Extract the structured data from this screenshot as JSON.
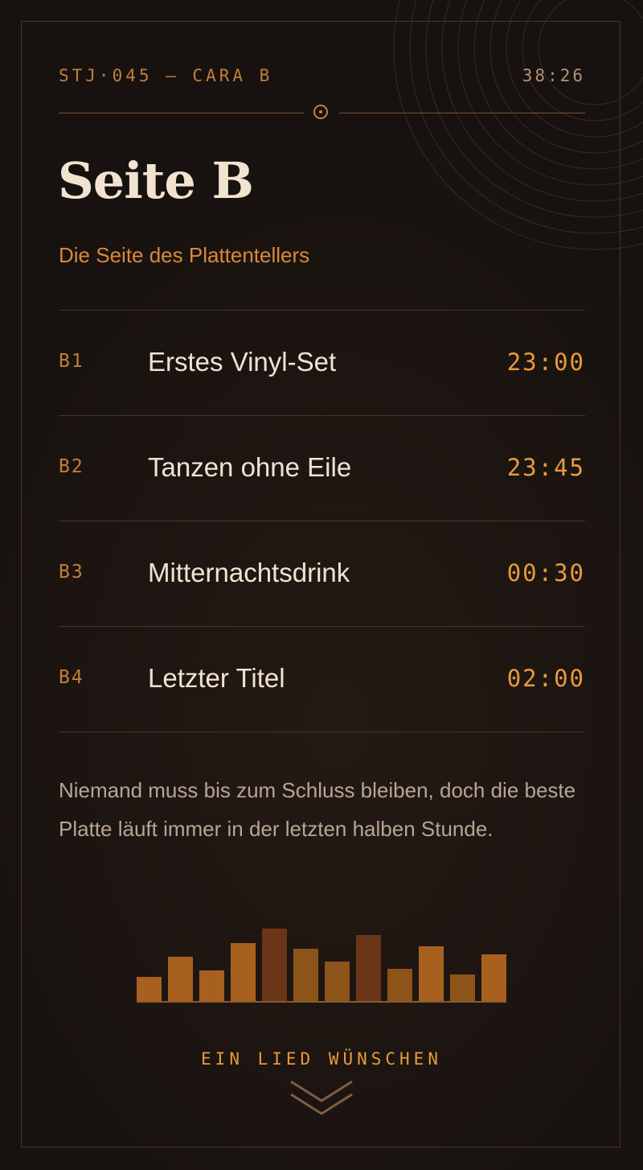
{
  "header": {
    "catalog": "STJ·045 — CARA B",
    "duration": "38:26"
  },
  "page": {
    "title": "Seite B",
    "subtitle": "Die Seite des Plattentellers"
  },
  "tracks": [
    {
      "no": "B1",
      "name": "Erstes Vinyl-Set",
      "time": "23:00"
    },
    {
      "no": "B2",
      "name": "Tanzen ohne Eile",
      "time": "23:45"
    },
    {
      "no": "B3",
      "name": "Mitternachtsdrink",
      "time": "00:30"
    },
    {
      "no": "B4",
      "name": "Letzter Titel",
      "time": "02:00"
    }
  ],
  "note": "Niemand muss bis zum Schluss bleiben, doch die beste Platte läuft immer in der letzten halben Stunde.",
  "equalizer": {
    "levels": [
      0.3,
      0.54,
      0.38,
      0.7,
      0.87,
      0.63,
      0.48,
      0.79,
      0.4,
      0.66,
      0.33,
      0.57
    ],
    "colors": [
      "#a8601e",
      "#a8601e",
      "#a8601e",
      "#a8601e",
      "#6b3518",
      "#8c5418",
      "#8c5418",
      "#6b3518",
      "#8c5418",
      "#a8601e",
      "#8c5418",
      "#a8601e"
    ]
  },
  "cta": {
    "label": "EIN LIED WÜNSCHEN",
    "icon": "chevron-down-icon"
  },
  "colors": {
    "accent": "#e89a3c",
    "text": "#f1e3d0",
    "background": "#1a1310"
  }
}
